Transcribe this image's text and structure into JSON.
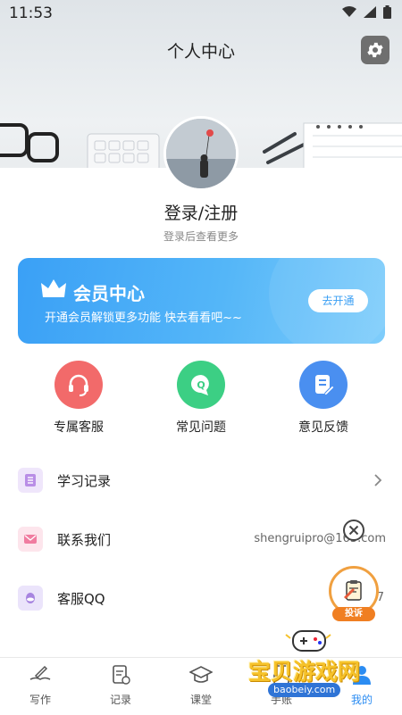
{
  "status_bar": {
    "time": "11:53"
  },
  "header": {
    "title": "个人中心",
    "settings_icon": "gear-icon"
  },
  "profile": {
    "login_label": "登录/注册",
    "login_hint": "登录后查看更多"
  },
  "vip_banner": {
    "title": "会员中心",
    "subtitle": "开通会员解锁更多功能 快去看看吧~~",
    "button_label": "去开通",
    "accent": "#3aa0f6"
  },
  "quick_actions": [
    {
      "label": "专属客服",
      "icon": "headset-icon",
      "color": "#f26a6a"
    },
    {
      "label": "常见问题",
      "icon": "question-chat-icon",
      "color": "#3ccf84"
    },
    {
      "label": "意见反馈",
      "icon": "edit-document-icon",
      "color": "#4a8ff0"
    }
  ],
  "menu": [
    {
      "label": "学习记录",
      "value": "",
      "icon": "record-icon"
    },
    {
      "label": "联系我们",
      "value": "shengruipro@163.com",
      "icon": "mail-icon"
    },
    {
      "label": "客服QQ",
      "value": "QQ 7",
      "icon": "qq-icon"
    }
  ],
  "floating": {
    "complain_label": "投诉"
  },
  "tabbar": [
    {
      "label": "写作",
      "icon": "book-pen-icon"
    },
    {
      "label": "记录",
      "icon": "notes-icon"
    },
    {
      "label": "课堂",
      "icon": "graduation-cap-icon"
    },
    {
      "label": "手账",
      "icon": "diary-icon"
    },
    {
      "label": "我的",
      "icon": "user-icon",
      "active": true
    }
  ],
  "watermark": {
    "text": "宝贝游戏网",
    "url": "baobeiy.com"
  }
}
